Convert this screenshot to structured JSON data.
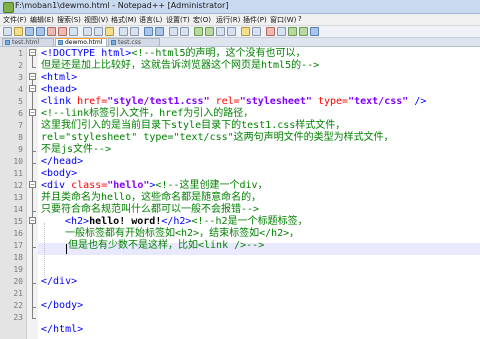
{
  "window": {
    "title": "F:\\moban1\\dewmo.html - Notepad++ [Administrator]"
  },
  "menu": [
    "文件(F)",
    "编辑(E)",
    "搜索(S)",
    "视图(V)",
    "格式(M)",
    "语言(L)",
    "设置(T)",
    "宏(O)",
    "运行(R)",
    "插件(P)",
    "窗口(W)",
    "?"
  ],
  "tabs": [
    {
      "label": "test.html"
    },
    {
      "label": "dewmo.html"
    },
    {
      "label": "test.css"
    }
  ],
  "editor": {
    "line_numbers": [
      "1",
      "2",
      "3",
      "4",
      "5",
      "6",
      "7",
      "8",
      "9",
      "10",
      "11",
      "12",
      "13",
      "14",
      "15",
      "16",
      "17",
      "18",
      "19",
      "20",
      "21",
      "22",
      "23"
    ],
    "code": {
      "l1a": "<!DOCTYPE html>",
      "l1b": "<!--html5的声明，这个没有也可以，",
      "l2": "但是还是加上比较好，这就告诉浏览器这个网页是html5的-->",
      "l3": "<html>",
      "l4": "<head>",
      "l5a": "<link ",
      "l5b": "href=",
      "l5c": "\"style/test1.css\"",
      "l5d": " rel=",
      "l5e": "\"stylesheet\"",
      "l5f": " type=",
      "l5g": "\"text/css\"",
      "l5h": " />",
      "l6": "<!--link标签引入文件，href为引入的路径，",
      "l7": "这里我们引入的是当前目录下style目录下的test1.css样式文件，",
      "l8": "rel=\"stylesheet\" type=\"text/css\"这两句声明文件的类型为样式文件，",
      "l9": "不是js文件-->",
      "l10": "</head>",
      "l11": "<body>",
      "l12a": "<div ",
      "l12b": "class=",
      "l12c": "\"hello\"",
      "l12d": ">",
      "l12e": "<!--这里创建一个div，",
      "l13": "并且类命名为hello，这些命名都是随意命名的，",
      "l14": "只要符合命名规范叫什么都可以一般不会报错-->",
      "l15a": "<h2>",
      "l15b": "hello! word!",
      "l15c": "</h2>",
      "l15d": "<!--h2是一个标题标签，",
      "l16": "一般标签都有开始标签如<h2>，结束标签如</h2>，",
      "l17": "但是也有少数不是这样，比如<link />-->",
      "l19": "</div>",
      "l21": "</body>",
      "l23": "</html>"
    }
  },
  "colors": {
    "tag": "#0000ff",
    "comment": "#008000",
    "attribute": "#ff0000",
    "value": "#8000ff",
    "current_line": "#e8e8ff"
  }
}
